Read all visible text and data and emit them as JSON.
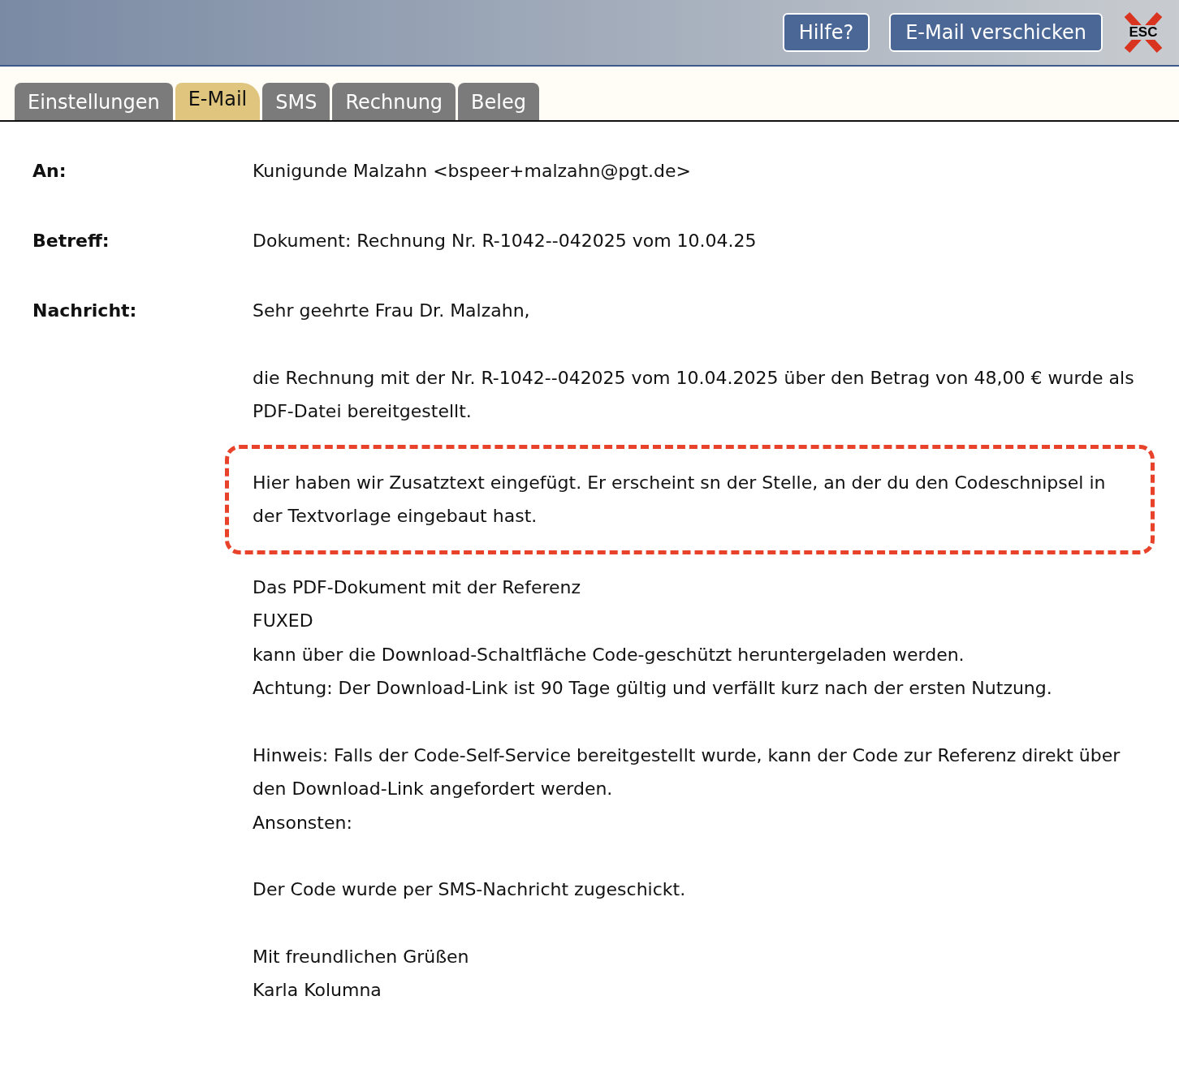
{
  "header": {
    "buttons": [
      {
        "label": "Hilfe?"
      },
      {
        "label": "E-Mail verschicken"
      }
    ],
    "close": {
      "label": "ESC"
    }
  },
  "tabs": [
    {
      "label": "Einstellungen",
      "selected": false
    },
    {
      "label": "E-Mail",
      "selected": true
    },
    {
      "label": "SMS",
      "selected": false
    },
    {
      "label": "Rechnung",
      "selected": false
    },
    {
      "label": "Beleg",
      "selected": false
    }
  ],
  "fields": [
    {
      "label": "An:",
      "value": "Kunigunde Malzahn <bspeer+malzahn@pgt.de>"
    },
    {
      "label": "Betreff:",
      "value": "Dokument: Rechnung Nr. R-1042--042025 vom 10.04.25"
    }
  ],
  "message": {
    "label": "Nachricht:",
    "paragraphs": [
      {
        "highlighted": false,
        "lines": [
          "Sehr geehrte Frau Dr. Malzahn,"
        ]
      },
      {
        "highlighted": false,
        "lines": [
          "die Rechnung mit der Nr. R-1042--042025 vom 10.04.2025 über den Betrag von 48,00 € wurde als PDF-Datei bereitgestellt."
        ]
      },
      {
        "highlighted": true,
        "lines": [
          "Hier haben wir Zusatztext eingefügt. Er erscheint sn der Stelle, an der du den Codeschnipsel in der Textvorlage eingebaut hast."
        ]
      },
      {
        "highlighted": false,
        "lines": [
          "Das PDF-Dokument mit der Referenz",
          "FUXED",
          "kann über die Download-Schaltfläche Code-geschützt heruntergeladen werden.",
          "Achtung: Der Download-Link ist 90 Tage gültig und verfällt kurz nach der ersten Nutzung."
        ]
      },
      {
        "highlighted": false,
        "lines": [
          "Hinweis: Falls der Code-Self-Service bereitgestellt wurde, kann der Code zur Referenz direkt über den Download-Link angefordert werden.",
          "Ansonsten:"
        ]
      },
      {
        "highlighted": false,
        "lines": [
          "Der Code wurde per SMS-Nachricht zugeschickt."
        ]
      },
      {
        "highlighted": false,
        "lines": [
          "Mit freundlichen Grüßen",
          "Karla Kolumna"
        ]
      }
    ]
  }
}
